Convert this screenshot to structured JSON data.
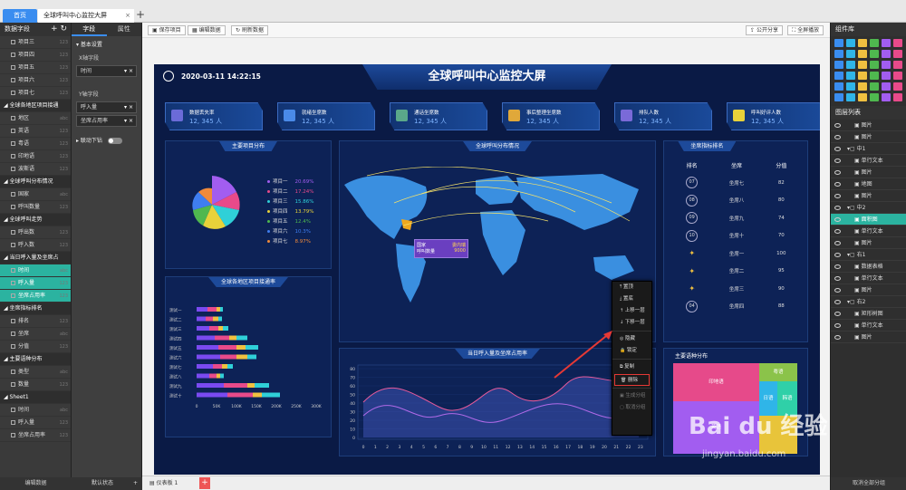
{
  "tabs": {
    "home": "首页",
    "doc": "全球呼叫中心监控大屏",
    "close": "×",
    "add": "+"
  },
  "left_panel": {
    "title": "数据字段",
    "items": [
      {
        "label": "项目三",
        "type": "item",
        "dtype": "123"
      },
      {
        "label": "项目四",
        "type": "item",
        "dtype": "123"
      },
      {
        "label": "项目五",
        "type": "item",
        "dtype": "123"
      },
      {
        "label": "项目六",
        "type": "item",
        "dtype": "123"
      },
      {
        "label": "项目七",
        "type": "item",
        "dtype": "123"
      },
      {
        "label": "全球各地区项目接通",
        "type": "group",
        "dtype": ""
      },
      {
        "label": "地区",
        "type": "item",
        "dtype": "abc"
      },
      {
        "label": "英语",
        "type": "item",
        "dtype": "123"
      },
      {
        "label": "粤语",
        "type": "item",
        "dtype": "123"
      },
      {
        "label": "印地语",
        "type": "item",
        "dtype": "123"
      },
      {
        "label": "波斯语",
        "type": "item",
        "dtype": "123"
      },
      {
        "label": "全球呼叫分布情况",
        "type": "group",
        "dtype": ""
      },
      {
        "label": "国家",
        "type": "item",
        "dtype": "abc"
      },
      {
        "label": "呼叫数量",
        "type": "item",
        "dtype": "123"
      },
      {
        "label": "全球呼叫走势",
        "type": "group",
        "dtype": ""
      },
      {
        "label": "呼出数",
        "type": "item",
        "dtype": "123"
      },
      {
        "label": "呼入数",
        "type": "item",
        "dtype": "123"
      },
      {
        "label": "当日呼入量及坐席占",
        "type": "group",
        "dtype": ""
      },
      {
        "label": "时间",
        "type": "sel",
        "dtype": "abc"
      },
      {
        "label": "呼入量",
        "type": "sel",
        "dtype": "123"
      },
      {
        "label": "坐席占用率",
        "type": "sel",
        "dtype": "123"
      },
      {
        "label": "坐席指标排名",
        "type": "group",
        "dtype": ""
      },
      {
        "label": "排名",
        "type": "item",
        "dtype": "123"
      },
      {
        "label": "坐席",
        "type": "item",
        "dtype": "abc"
      },
      {
        "label": "分值",
        "type": "item",
        "dtype": "123"
      },
      {
        "label": "主要语种分布",
        "type": "group",
        "dtype": ""
      },
      {
        "label": "类型",
        "type": "item",
        "dtype": "abc"
      },
      {
        "label": "数量",
        "type": "item",
        "dtype": "123"
      },
      {
        "label": "Sheet1",
        "type": "group",
        "dtype": ""
      },
      {
        "label": "时间",
        "type": "item",
        "dtype": "abc"
      },
      {
        "label": "呼入量",
        "type": "item",
        "dtype": "123"
      },
      {
        "label": "坐席占用率",
        "type": "item",
        "dtype": "123"
      }
    ],
    "footer": "编辑数据"
  },
  "field_panel": {
    "tab_field": "字段",
    "tab_attr": "属性",
    "section": "基本设置",
    "x_label": "X轴字段",
    "x_value": "时间",
    "y_label": "Y轴字段",
    "y1": "呼入量",
    "y2": "坐席占用率",
    "linkage": "联动下钻",
    "footer": "默认状态"
  },
  "toolbar": {
    "save": "保存项目",
    "edit": "编辑数据",
    "refresh": "刷新数据",
    "share": "公开分享",
    "preview": "全屏播放"
  },
  "screen": {
    "title": "全球呼叫中心监控大屏",
    "time": "2020-03-11 14:22:15",
    "kpis": [
      {
        "name": "数据丢失率",
        "value": "12, 345 人"
      },
      {
        "name": "就绪坐席数",
        "value": "12, 345 人"
      },
      {
        "name": "通话坐席数",
        "value": "12, 345 人"
      },
      {
        "name": "事后整理坐席数",
        "value": "12, 345 人"
      },
      {
        "name": "排队人数",
        "value": "12, 345 人"
      },
      {
        "name": "呼叫好评人数",
        "value": "12, 345 人"
      }
    ],
    "panel_project": "主要项目分布",
    "panel_map": "全球呼叫分布情况",
    "panel_rank": "坐席指标排名",
    "panel_region": "全球各地区项目接通率",
    "panel_line": "当日呼入量及坐席占用率",
    "panel_lang": "主要语种分布",
    "legend": [
      {
        "label": "项目一",
        "pct": "20.69%"
      },
      {
        "label": "项目二",
        "pct": "17.24%"
      },
      {
        "label": "项目三",
        "pct": "15.86%"
      },
      {
        "label": "项目四",
        "pct": "13.79%"
      },
      {
        "label": "项目五",
        "pct": "12.4%"
      },
      {
        "label": "项目六",
        "pct": "10.3%"
      },
      {
        "label": "项目七",
        "pct": "8.97%"
      }
    ],
    "rank_headers": [
      "排名",
      "坐席",
      "分值"
    ],
    "rank_rows": [
      {
        "rank": "07",
        "seat": "坐席七",
        "score": "82"
      },
      {
        "rank": "08",
        "seat": "坐席八",
        "score": "80"
      },
      {
        "rank": "09",
        "seat": "坐席九",
        "score": "74"
      },
      {
        "rank": "10",
        "seat": "坐席十",
        "score": "70"
      },
      {
        "rank": "",
        "seat": "坐席一",
        "score": "100"
      },
      {
        "rank": "",
        "seat": "坐席二",
        "score": "95"
      },
      {
        "rank": "",
        "seat": "坐席三",
        "score": "90"
      },
      {
        "rank": "04",
        "seat": "坐席四",
        "score": "88"
      }
    ],
    "tooltip": {
      "country": "国家",
      "country_val": "委内瑞",
      "calls": "呼叫数量",
      "calls_val": "9000"
    },
    "lang_labels": {
      "en_big": "英语",
      "hindi": "印地语",
      "cantonese": "粤语",
      "japanese": "日语",
      "korean": "韩语"
    }
  },
  "bar_chart": {
    "categories": [
      "测试一",
      "测试二",
      "测试三",
      "测试四",
      "测试五",
      "测试六",
      "测试七",
      "测试八",
      "测试九",
      "测试十"
    ],
    "xticks": [
      "0",
      "50K",
      "100K",
      "150K",
      "200K",
      "250K",
      "300K"
    ]
  },
  "line_chart": {
    "yticks": [
      "80",
      "70",
      "60",
      "50",
      "40",
      "30",
      "20",
      "10",
      "0"
    ],
    "xticks": [
      "0",
      "1",
      "2",
      "3",
      "4",
      "5",
      "6",
      "7",
      "8",
      "9",
      "10",
      "11",
      "12",
      "13",
      "14",
      "15",
      "16",
      "17",
      "18",
      "19",
      "20",
      "21",
      "22",
      "23"
    ]
  },
  "context_menu": [
    {
      "label": "置顶",
      "state": "normal"
    },
    {
      "label": "置底",
      "state": "normal"
    },
    {
      "label": "上移一层",
      "state": "normal"
    },
    {
      "label": "下移一层",
      "state": "normal"
    },
    {
      "label": "隐藏",
      "state": "normal"
    },
    {
      "label": "锁定",
      "state": "normal"
    },
    {
      "label": "复制",
      "state": "normal"
    },
    {
      "label": "删除",
      "state": "del"
    },
    {
      "label": "生成分组",
      "state": "dis"
    },
    {
      "label": "取消分组",
      "state": "dis"
    }
  ],
  "right_panel": {
    "title": "组件库",
    "layers_title": "图层列表",
    "layers": [
      {
        "label": "图片",
        "kind": "item"
      },
      {
        "label": "图片",
        "kind": "item"
      },
      {
        "label": "中1",
        "kind": "grp"
      },
      {
        "label": "单行文本",
        "kind": "item"
      },
      {
        "label": "图片",
        "kind": "item"
      },
      {
        "label": "地图",
        "kind": "item"
      },
      {
        "label": "图片",
        "kind": "item"
      },
      {
        "label": "中2",
        "kind": "grp"
      },
      {
        "label": "面积图",
        "kind": "sel"
      },
      {
        "label": "单行文本",
        "kind": "item"
      },
      {
        "label": "图片",
        "kind": "item"
      },
      {
        "label": "右1",
        "kind": "grp"
      },
      {
        "label": "数据表格",
        "kind": "item"
      },
      {
        "label": "单行文本",
        "kind": "item"
      },
      {
        "label": "图片",
        "kind": "item"
      },
      {
        "label": "右2",
        "kind": "grp"
      },
      {
        "label": "矩形树图",
        "kind": "item"
      },
      {
        "label": "单行文本",
        "kind": "item"
      },
      {
        "label": "图片",
        "kind": "item"
      }
    ],
    "footer": "取消全部分组"
  },
  "bottom": {
    "tab": "仪表板 1",
    "add": "+"
  },
  "watermark": {
    "brand": "Bai du 经验",
    "url": "jingyan.baidu.com"
  },
  "colors": {
    "accent": "#3a8df0",
    "selected": "#2bb3a0",
    "screen_bg": "#0a1a45",
    "delete_border": "#e53935"
  }
}
